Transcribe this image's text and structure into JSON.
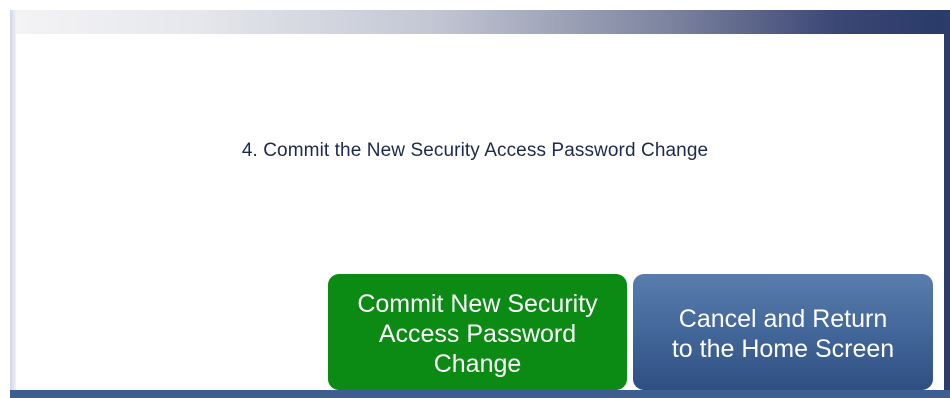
{
  "instruction": {
    "text": "4. Commit the New Security Access Password Change"
  },
  "buttons": {
    "commit": {
      "lines": [
        "Commit New Security",
        "Access Password",
        "Change"
      ],
      "color": "#0b8a14"
    },
    "cancel": {
      "lines": [
        "Cancel and Return",
        "to the Home Screen"
      ],
      "color": "#3e5e92"
    }
  }
}
